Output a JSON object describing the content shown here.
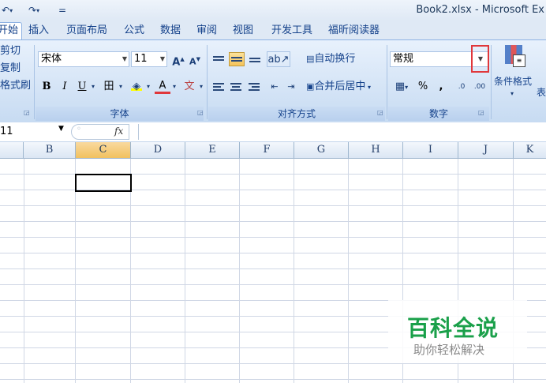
{
  "titlebar": {
    "undo_icon": "undo-icon",
    "redo_icon": "redo-icon",
    "qat_more": "=",
    "title": "Book2.xlsx - Microsoft Ex"
  },
  "tabs": [
    {
      "label": "开始",
      "active": true
    },
    {
      "label": "插入"
    },
    {
      "label": "页面布局"
    },
    {
      "label": "公式"
    },
    {
      "label": "数据"
    },
    {
      "label": "审阅"
    },
    {
      "label": "视图"
    },
    {
      "label": "开发工具"
    },
    {
      "label": "福昕阅读器"
    }
  ],
  "clipboard": {
    "cut": "剪切",
    "copy": "复制",
    "format_painter": "格式刷"
  },
  "font": {
    "name": "宋体",
    "size": "11",
    "grow": "A",
    "shrink": "A",
    "bold": "B",
    "italic": "I",
    "underline": "U",
    "border": "田",
    "font_color": "A",
    "phonetic": "文",
    "group_label": "字体"
  },
  "alignment": {
    "wrap_text": "自动换行",
    "merge_center": "合并后居中",
    "group_label": "对齐方式"
  },
  "number": {
    "format": "常规",
    "percent": "%",
    "comma": ",",
    "inc_decimal": ".0",
    "dec_decimal": ".00",
    "group_label": "数字"
  },
  "styles": {
    "conditional_format": "条件格式",
    "table_format_partial": "表"
  },
  "formula_bar": {
    "name_box": "11",
    "fx": "fx"
  },
  "columns": [
    "B",
    "C",
    "D",
    "E",
    "F",
    "G",
    "H",
    "I",
    "J",
    "K"
  ],
  "selected_column": "C",
  "watermark": {
    "title": "百科全说",
    "subtitle": "助你轻松解决"
  },
  "colors": {
    "accent": "#15428b",
    "ribbon_bg": "#dfe9f5",
    "highlight_red": "#e0373b",
    "watermark_green": "#1aa04a"
  }
}
